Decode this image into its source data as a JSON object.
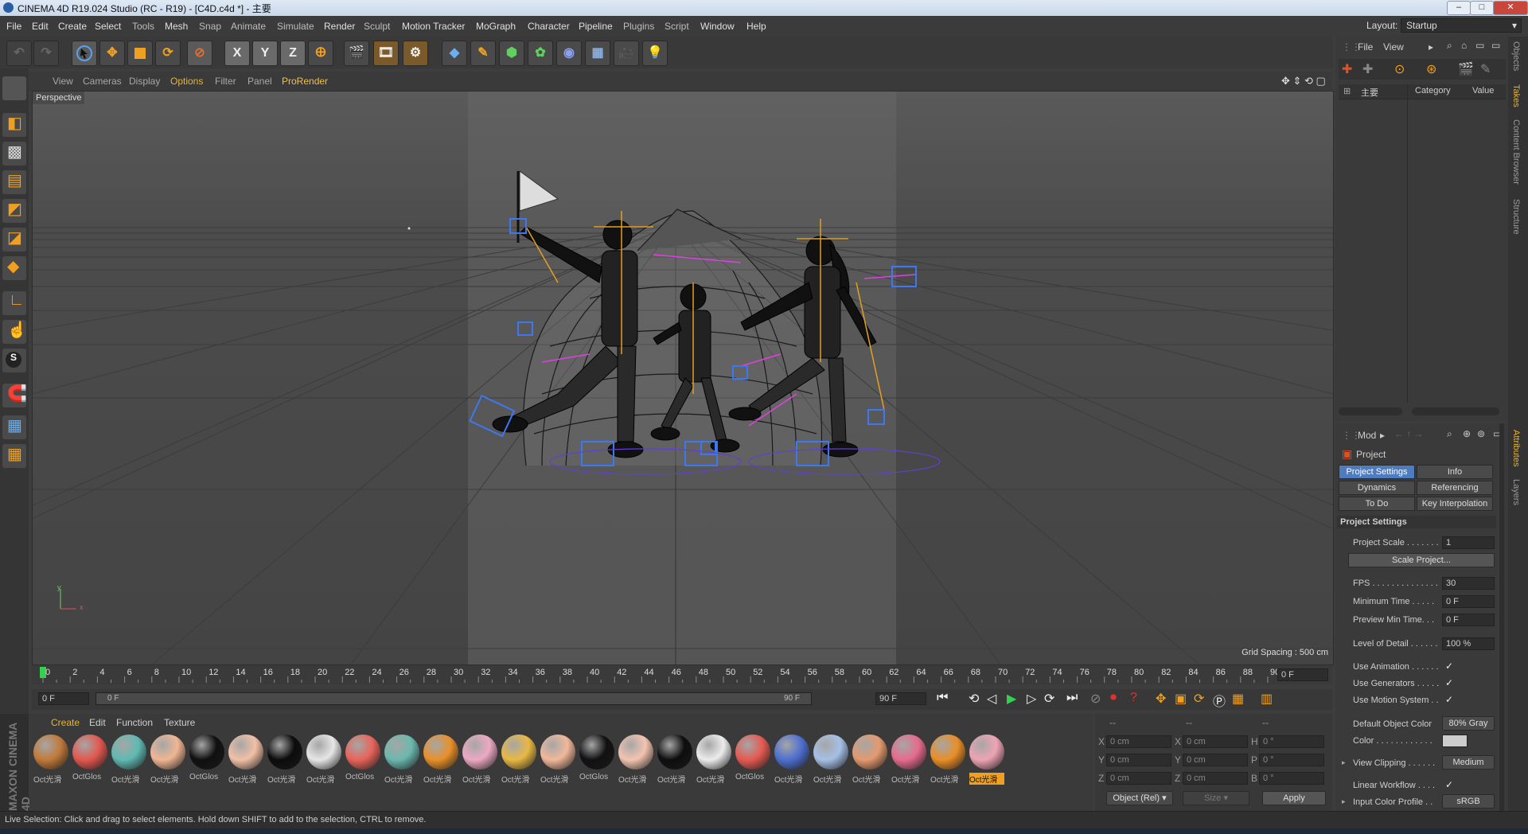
{
  "window": {
    "title": "CINEMA 4D R19.024 Studio (RC - R19) - [C4D.c4d *] - 主要",
    "controls": [
      "minimize",
      "maximize",
      "close"
    ]
  },
  "menu": [
    "File",
    "Edit",
    "Create",
    "Select",
    "Tools",
    "Mesh",
    "Snap",
    "Animate",
    "Simulate",
    "Render",
    "Sculpt",
    "Motion Tracker",
    "MoGraph",
    "Character",
    "Pipeline",
    "Plugins",
    "Script",
    "Window",
    "Help"
  ],
  "layout": {
    "label": "Layout:",
    "value": "Startup"
  },
  "toolbar": {
    "undo_icon": "undo-icon",
    "axes": [
      "X",
      "Y",
      "Z"
    ]
  },
  "viewport": {
    "menu": [
      "View",
      "Cameras",
      "Display",
      "Options",
      "Filter",
      "Panel",
      "ProRender"
    ],
    "camera_label": "Perspective",
    "grid_spacing": "Grid Spacing : 500 cm",
    "axis_y": "y",
    "axis_x": "x"
  },
  "timeline": {
    "ticks": [
      "0",
      "2",
      "4",
      "6",
      "8",
      "10",
      "12",
      "14",
      "16",
      "18",
      "20",
      "22",
      "24",
      "26",
      "28",
      "30",
      "32",
      "34",
      "36",
      "38",
      "40",
      "42",
      "44",
      "46",
      "48",
      "50",
      "52",
      "54",
      "56",
      "58",
      "60",
      "62",
      "64",
      "66",
      "68",
      "70",
      "72",
      "74",
      "76",
      "78",
      "80",
      "82",
      "84",
      "86",
      "88",
      "90"
    ],
    "current_frame": "0 F",
    "start_field": "0 F",
    "range_start": "0 F",
    "range_end": "90 F",
    "end_field": "90 F"
  },
  "materials": {
    "menu": [
      "Create",
      "Edit",
      "Function",
      "Texture"
    ],
    "items": [
      {
        "label": "Oct光滑",
        "color": "#c07a3a"
      },
      {
        "label": "OctGlos",
        "color": "#e2584f"
      },
      {
        "label": "Oct光滑",
        "color": "#5fb9b2"
      },
      {
        "label": "Oct光滑",
        "color": "#f0b693"
      },
      {
        "label": "OctGlos",
        "color": "#101010"
      },
      {
        "label": "Oct光滑",
        "color": "#f2c0a6"
      },
      {
        "label": "Oct光滑",
        "color": "#0c0c0c"
      },
      {
        "label": "Oct光滑",
        "color": "#e6e6e6"
      },
      {
        "label": "OctGlos",
        "color": "#e8645a"
      },
      {
        "label": "Oct光滑",
        "color": "#6bb8ae"
      },
      {
        "label": "Oct光滑",
        "color": "#e9902a"
      },
      {
        "label": "Oct光滑",
        "color": "#eda9c2"
      },
      {
        "label": "Oct光滑",
        "color": "#e9b844"
      },
      {
        "label": "Oct光滑",
        "color": "#f1b89a"
      },
      {
        "label": "OctGlos",
        "color": "#111111"
      },
      {
        "label": "Oct光滑",
        "color": "#f3c4b0"
      },
      {
        "label": "Oct光滑",
        "color": "#0e0e0e"
      },
      {
        "label": "Oct光滑",
        "color": "#ececec"
      },
      {
        "label": "OctGlos",
        "color": "#e55a52"
      },
      {
        "label": "Oct光滑",
        "color": "#4d6fd0"
      },
      {
        "label": "Oct光滑",
        "color": "#a5c0e6"
      },
      {
        "label": "Oct光滑",
        "color": "#e49a6e"
      },
      {
        "label": "Oct光滑",
        "color": "#e66b8d"
      },
      {
        "label": "Oct光滑",
        "color": "#ea8e27"
      },
      {
        "label": "Oct光滑",
        "color": "#efa3b4"
      }
    ],
    "selected_index": 24
  },
  "coordinates": {
    "headers": [
      "--",
      "--",
      "--"
    ],
    "rows": [
      {
        "a": "X",
        "av": "0 cm",
        "b": "X",
        "bv": "0 cm",
        "c": "H",
        "cv": "0 °"
      },
      {
        "a": "Y",
        "av": "0 cm",
        "b": "Y",
        "bv": "0 cm",
        "c": "P",
        "cv": "0 °"
      },
      {
        "a": "Z",
        "av": "0 cm",
        "b": "Z",
        "bv": "0 cm",
        "c": "B",
        "cv": "0 °"
      }
    ],
    "mode": "Object (Rel)",
    "size_mode": "Size",
    "apply": "Apply"
  },
  "objects": {
    "menu": [
      "File",
      "View"
    ],
    "root_label": "主要",
    "col_category": "Category",
    "col_value": "Value"
  },
  "attributes": {
    "menu": "Mod",
    "title": "Project",
    "tabs": [
      "Project Settings",
      "Info",
      "Dynamics",
      "Referencing",
      "To Do",
      "Key Interpolation"
    ],
    "section": "Project Settings",
    "rows": [
      {
        "label": "Project Scale . . . . . . .",
        "value": "1"
      },
      {
        "label": "FPS . . . . . . . . . . . . . .",
        "value": "30"
      },
      {
        "label": "Minimum Time . . . . .",
        "value": "0 F"
      },
      {
        "label": "Preview Min Time. . .",
        "value": "0 F"
      },
      {
        "label": "Level of Detail . . . . . .",
        "value": "100 %"
      }
    ],
    "scale_button": "Scale Project...",
    "checks": [
      {
        "label": "Use Animation . . . . . .",
        "checked": "✓"
      },
      {
        "label": "Use Generators . . . . .",
        "checked": "✓"
      },
      {
        "label": "Use Motion System . .",
        "checked": "✓"
      }
    ],
    "default_color_label": "Default Object Color",
    "default_color_value": "80% Gray",
    "color_label": "Color . . . . . . . . . . . .",
    "view_clipping_label": "View Clipping . . . . . .",
    "view_clipping_value": "Medium",
    "linear_workflow_label": "Linear Workflow . . . .",
    "input_color_profile_label": "Input Color Profile . .",
    "input_color_profile_value": "sRGB"
  },
  "side_tabs": [
    "Objects",
    "Takes",
    "Content Browser",
    "Structure",
    "Attributes",
    "Layers"
  ],
  "status": "Live Selection: Click and drag to select elements. Hold down SHIFT to add to the selection, CTRL to remove.",
  "brand": "MAXON CINEMA 4D"
}
